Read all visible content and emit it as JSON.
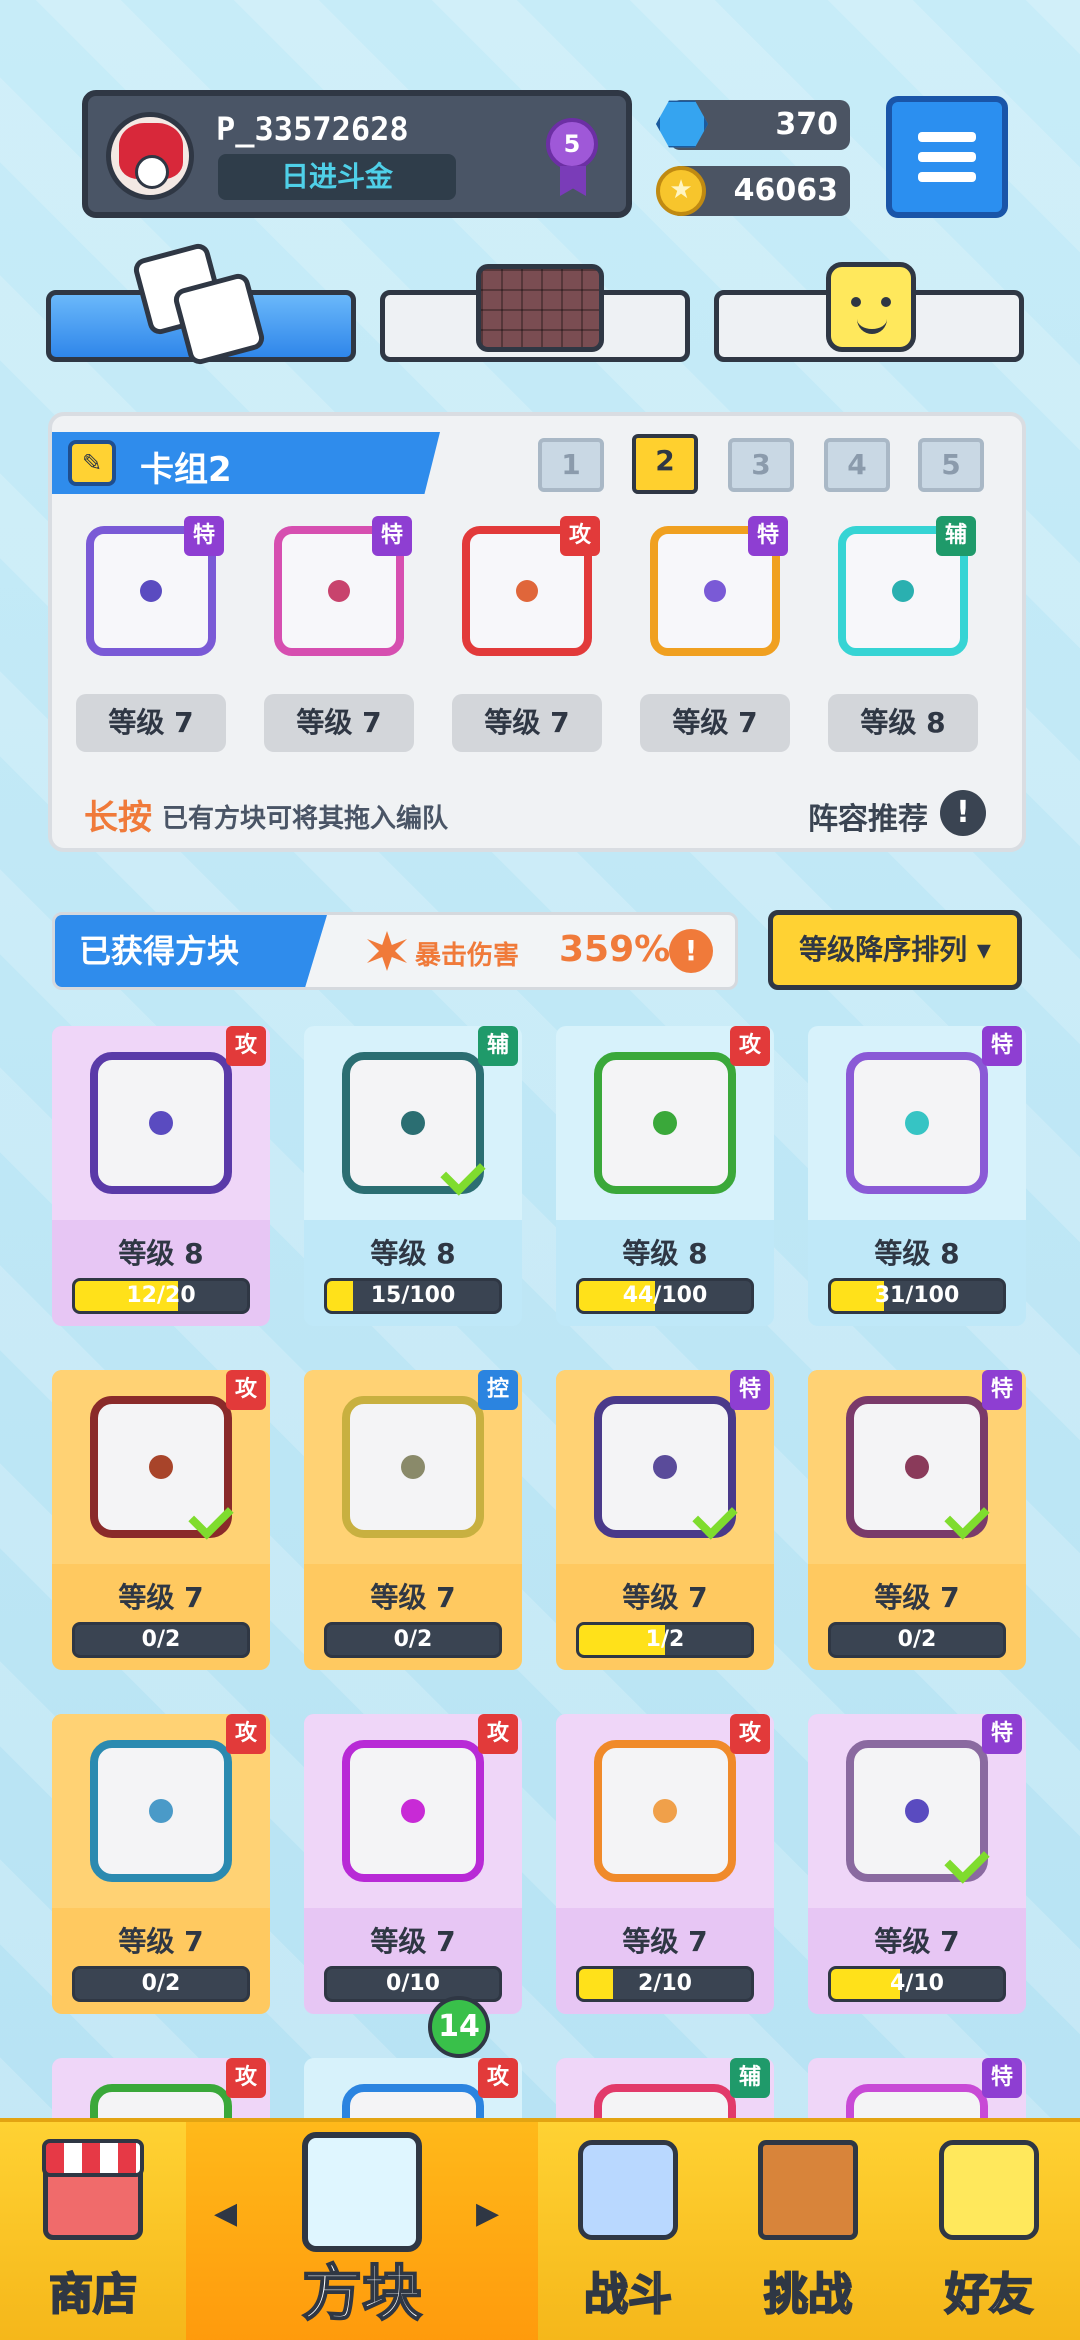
{
  "player": {
    "name": "P_33572628",
    "rank": "日进斗金",
    "level_badge": "5",
    "gems": "370",
    "coins": "46063"
  },
  "icons": {
    "gem": "gem-icon",
    "coin": "coin-icon",
    "menu": "menu-icon",
    "dice": "dice-icon",
    "grid": "grid-icon",
    "smile": "smile-icon"
  },
  "deck": {
    "title": "卡组2",
    "tabs": [
      "1",
      "2",
      "3",
      "4",
      "5"
    ],
    "active_tab": "2",
    "cards": [
      {
        "tag": "特",
        "tag_type": "special",
        "level": "等级 7",
        "color": "#7a5ad6",
        "dot": "#5a4bc0"
      },
      {
        "tag": "特",
        "tag_type": "special",
        "level": "等级 7",
        "color": "#d64fb0",
        "dot": "#c8436d"
      },
      {
        "tag": "攻",
        "tag_type": "attack",
        "level": "等级 7",
        "color": "#e23a3a",
        "dot": "#e0663a"
      },
      {
        "tag": "特",
        "tag_type": "special",
        "level": "等级 7",
        "color": "#f0a020",
        "dot": "#7a5ad6"
      },
      {
        "tag": "辅",
        "tag_type": "support",
        "level": "等级 8",
        "color": "#36d4d4",
        "dot": "#2ab0b0"
      }
    ],
    "hint_highlight": "长按",
    "hint_text": "已有方块可将其拖入编队",
    "recommend_label": "阵容推荐",
    "recommend_icon": "!"
  },
  "obtained": {
    "label": "已获得方块",
    "crit_label": "暴击伤害",
    "crit_value": "359%",
    "crit_info": "!",
    "sort_label": "等级降序排列 ▾"
  },
  "grid_cards": [
    {
      "tag": "攻",
      "tag_type": "attack",
      "level": "等级 8",
      "progress": "12/20",
      "fill": 0.6,
      "bg": "purple",
      "frame": "#5a3aa8",
      "dot": "#5a4bc0",
      "checked": false
    },
    {
      "tag": "辅",
      "tag_type": "support",
      "level": "等级 8",
      "progress": "15/100",
      "fill": 0.15,
      "bg": "blue",
      "frame": "#2b6e72",
      "dot": "#2b6e72",
      "checked": true
    },
    {
      "tag": "攻",
      "tag_type": "attack",
      "level": "等级 8",
      "progress": "44/100",
      "fill": 0.44,
      "bg": "blue",
      "frame": "#3aa83a",
      "dot": "#3aa83a",
      "checked": false
    },
    {
      "tag": "特",
      "tag_type": "special",
      "level": "等级 8",
      "progress": "31/100",
      "fill": 0.31,
      "bg": "blue",
      "frame": "#8a5ad6",
      "dot": "#36c4c4",
      "checked": false
    },
    {
      "tag": "攻",
      "tag_type": "attack",
      "level": "等级 7",
      "progress": "0/2",
      "fill": 0,
      "bg": "orange",
      "frame": "#8a2a2a",
      "dot": "#a8442a",
      "checked": true
    },
    {
      "tag": "控",
      "tag_type": "control",
      "level": "等级 7",
      "progress": "0/2",
      "fill": 0,
      "bg": "orange",
      "frame": "#c8b040",
      "dot": "#8a8a6a",
      "checked": false
    },
    {
      "tag": "特",
      "tag_type": "special",
      "level": "等级 7",
      "progress": "1/2",
      "fill": 0.5,
      "bg": "orange",
      "frame": "#4a3a8a",
      "dot": "#5a4b9a",
      "checked": true
    },
    {
      "tag": "特",
      "tag_type": "special",
      "level": "等级 7",
      "progress": "0/2",
      "fill": 0,
      "bg": "orange",
      "frame": "#7a3a6a",
      "dot": "#8a3a5a",
      "checked": true
    },
    {
      "tag": "攻",
      "tag_type": "attack",
      "level": "等级 7",
      "progress": "0/2",
      "fill": 0,
      "bg": "orange",
      "frame": "#2b8ab0",
      "dot": "#4a9ac8",
      "checked": false
    },
    {
      "tag": "攻",
      "tag_type": "attack",
      "level": "等级 7",
      "progress": "0/10",
      "fill": 0,
      "bg": "purple",
      "frame": "#b82ad6",
      "dot": "#c82ad6",
      "checked": false
    },
    {
      "tag": "攻",
      "tag_type": "attack",
      "level": "等级 7",
      "progress": "2/10",
      "fill": 0.2,
      "bg": "purple",
      "frame": "#f08a2a",
      "dot": "#f0a04a",
      "checked": false
    },
    {
      "tag": "特",
      "tag_type": "special",
      "level": "等级 7",
      "progress": "4/10",
      "fill": 0.4,
      "bg": "purple",
      "frame": "#8a6aa0",
      "dot": "#5a4bc0",
      "checked": true
    },
    {
      "tag": "攻",
      "tag_type": "attack",
      "level": "",
      "progress": "",
      "fill": 0,
      "bg": "purple",
      "frame": "#3aa83a",
      "dot": "#3aa83a",
      "checked": false
    },
    {
      "tag": "攻",
      "tag_type": "attack",
      "level": "",
      "progress": "",
      "fill": 0,
      "bg": "blue",
      "frame": "#2b84e0",
      "dot": "#2b84e0",
      "checked": false
    },
    {
      "tag": "辅",
      "tag_type": "support",
      "level": "",
      "progress": "",
      "fill": 0,
      "bg": "purple",
      "frame": "#e23a6a",
      "dot": "#e23a6a",
      "checked": false
    },
    {
      "tag": "特",
      "tag_type": "special",
      "level": "",
      "progress": "",
      "fill": 0,
      "bg": "purple",
      "frame": "#c84ad6",
      "dot": "#c84ad6",
      "checked": false
    }
  ],
  "nav": {
    "shop": "商店",
    "blocks": "方块",
    "battle": "战斗",
    "challenge": "挑战",
    "friends": "好友",
    "blocks_badge": "14",
    "arrow_left": "◀",
    "arrow_right": "▶"
  },
  "colors": {
    "attack": "#e23a3a",
    "special": "#8e3ed2",
    "support": "#1f9a6a",
    "control": "#2b84e0",
    "accent": "#2f8cec",
    "gold": "#ffd233"
  }
}
